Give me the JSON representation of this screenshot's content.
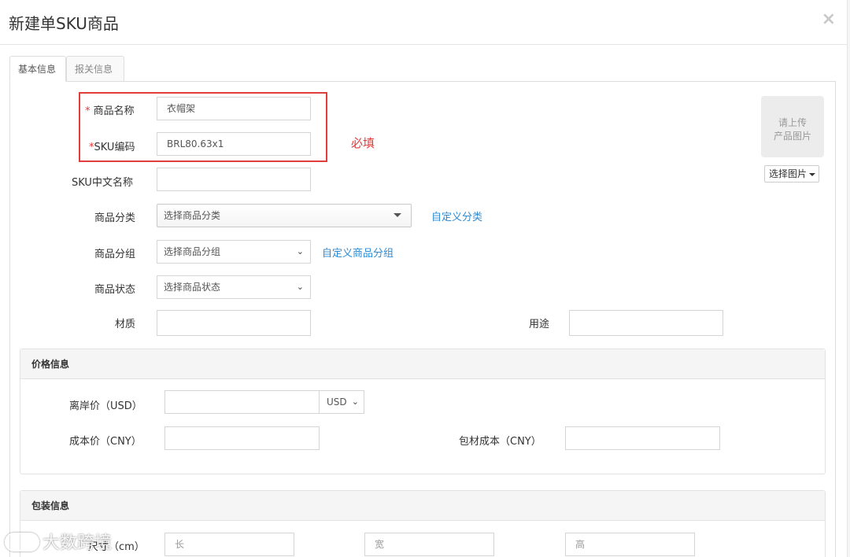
{
  "modal": {
    "title": "新建单SKU商品",
    "close_icon": "×"
  },
  "tabs": [
    {
      "label": "基本信息",
      "active": true
    },
    {
      "label": "报关信息",
      "active": false
    }
  ],
  "basic": {
    "product_name": {
      "label": "商品名称",
      "value": "衣帽架",
      "required_mark": "* "
    },
    "sku_code": {
      "label": "SKU编码",
      "value": "BRL80.63x1",
      "required_mark": "*"
    },
    "required_note": "必填",
    "sku_cn_name": {
      "label": "SKU中文名称",
      "value": ""
    },
    "category": {
      "label": "商品分类",
      "selected": "选择商品分类",
      "link": "自定义分类"
    },
    "group": {
      "label": "商品分组",
      "selected": "选择商品分组",
      "link": "自定义商品分组"
    },
    "status": {
      "label": "商品状态",
      "selected": "选择商品状态"
    },
    "material": {
      "label": "材质",
      "value": ""
    },
    "usage": {
      "label": "用途",
      "value": ""
    },
    "upload": {
      "line1": "请上传",
      "line2": "产品图片",
      "button": "选择图片"
    }
  },
  "price": {
    "title": "价格信息",
    "offshore_price": {
      "label": "离岸价（USD）",
      "value": "",
      "currency": "USD"
    },
    "cost_price": {
      "label": "成本价（CNY）",
      "value": ""
    },
    "packaging_cost": {
      "label": "包材成本（CNY）",
      "value": ""
    }
  },
  "packaging": {
    "title": "包装信息",
    "size": {
      "label": "尺寸（cm）",
      "length_placeholder": "长",
      "width_placeholder": "宽",
      "height_placeholder": "高"
    }
  },
  "watermark": {
    "text": "大数跨境"
  },
  "colors": {
    "accent_link": "#2e8bd3",
    "required_red": "#e23d3d"
  }
}
